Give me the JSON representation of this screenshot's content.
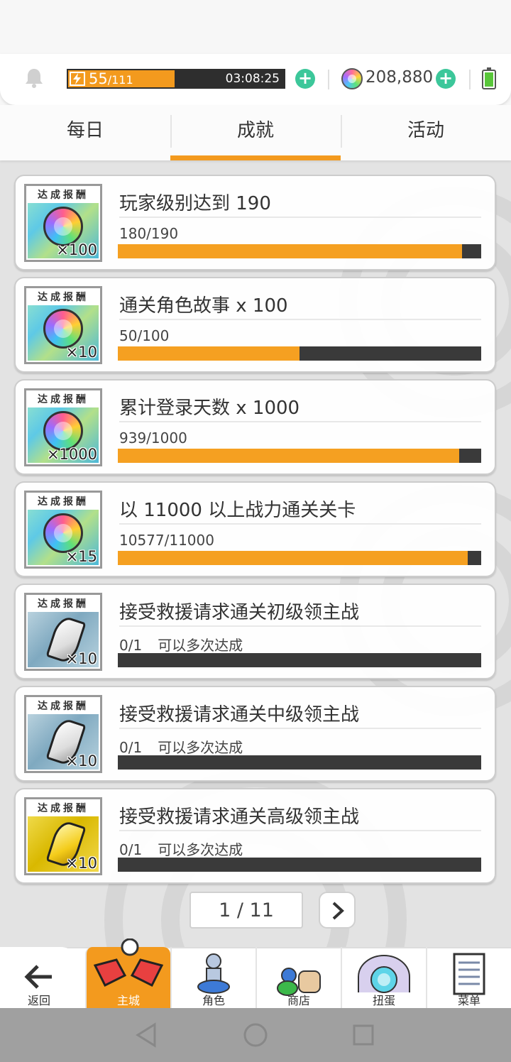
{
  "status": {
    "stamina_current": "55",
    "stamina_max": "/111",
    "stamina_fraction": 0.495,
    "stamina_timer": "03:08:25",
    "gems": "208,880"
  },
  "tabs": [
    {
      "label": "每日",
      "active": false
    },
    {
      "label": "成就",
      "active": true
    },
    {
      "label": "活动",
      "active": false
    }
  ],
  "reward_tag": "达成报酬",
  "achievements": [
    {
      "title": "玩家级别达到 190",
      "progress": "180/190",
      "note": "",
      "fraction": 0.947,
      "reward_icon": "rainbow-gem-icon",
      "reward_qty": "×100"
    },
    {
      "title": "通关角色故事 x 100",
      "progress": "50/100",
      "note": "",
      "fraction": 0.5,
      "reward_icon": "rainbow-gem-icon",
      "reward_qty": "×10"
    },
    {
      "title": "累计登录天数 x 1000",
      "progress": "939/1000",
      "note": "",
      "fraction": 0.939,
      "reward_icon": "rainbow-gem-icon",
      "reward_qty": "×1000"
    },
    {
      "title": "以 11000 以上战力通关关卡",
      "progress": "10577/11000",
      "note": "",
      "fraction": 0.962,
      "reward_icon": "rainbow-gem-icon",
      "reward_qty": "×15"
    },
    {
      "title": "接受救援请求通关初级领主战",
      "progress": "0/1",
      "note": "可以多次达成",
      "fraction": 0,
      "reward_icon": "silver-shard-icon",
      "reward_qty": "×10"
    },
    {
      "title": "接受救援请求通关中级领主战",
      "progress": "0/1",
      "note": "可以多次达成",
      "fraction": 0,
      "reward_icon": "silver-shard-icon",
      "reward_qty": "×10"
    },
    {
      "title": "接受救援请求通关高级领主战",
      "progress": "0/1",
      "note": "可以多次达成",
      "fraction": 0,
      "reward_icon": "gold-shard-icon",
      "reward_qty": "×10"
    }
  ],
  "pager": {
    "label": "1 / 11"
  },
  "bottom_nav": [
    {
      "label": "返回",
      "icon": "back-arrow-icon"
    },
    {
      "label": "主城",
      "icon": "castle-icon",
      "active": true
    },
    {
      "label": "角色",
      "icon": "character-icon"
    },
    {
      "label": "商店",
      "icon": "shop-icon"
    },
    {
      "label": "扭蛋",
      "icon": "gacha-icon"
    },
    {
      "label": "菜单",
      "icon": "menu-list-icon"
    }
  ],
  "colors": {
    "accent": "#f39a1e",
    "plus": "#3cc79a",
    "bar_bg": "#3a3a3a"
  }
}
